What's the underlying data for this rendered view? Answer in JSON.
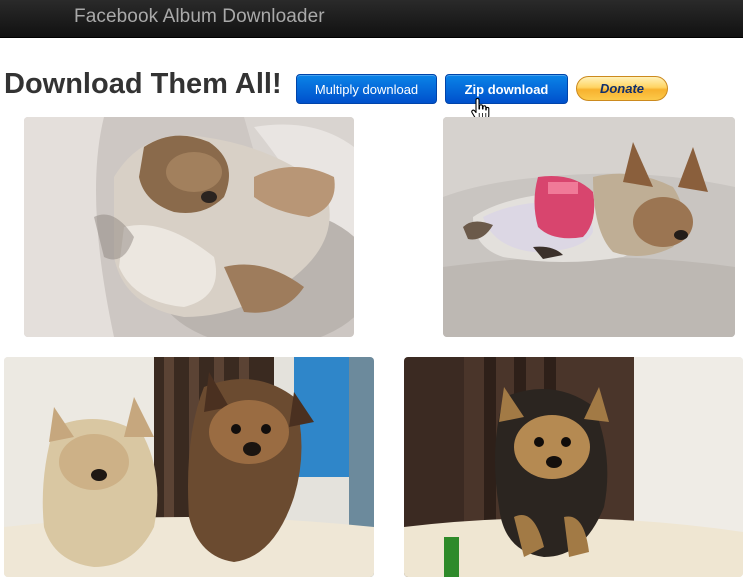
{
  "navbar": {
    "brand": "Facebook Album Downloader"
  },
  "main": {
    "heading": "Download Them All!",
    "buttons": {
      "multiply_label": "Multiply download",
      "zip_label": "Zip download",
      "donate_label": "Donate"
    }
  },
  "colors": {
    "navbar_bg": "#1a1a1a",
    "brand_text": "#a9a9a9",
    "heading_text": "#333333",
    "primary_button": "#0a6fe0",
    "donate_button": "#ffc439"
  },
  "icons": {
    "cursor": "hand-pointer-icon"
  },
  "photos": [
    {
      "subject": "yorkie-lying-on-couch"
    },
    {
      "subject": "yorkie-in-pink-vest-sleeping"
    },
    {
      "subject": "two-yorkies-on-chair"
    },
    {
      "subject": "yorkie-puppy-on-chair"
    }
  ]
}
